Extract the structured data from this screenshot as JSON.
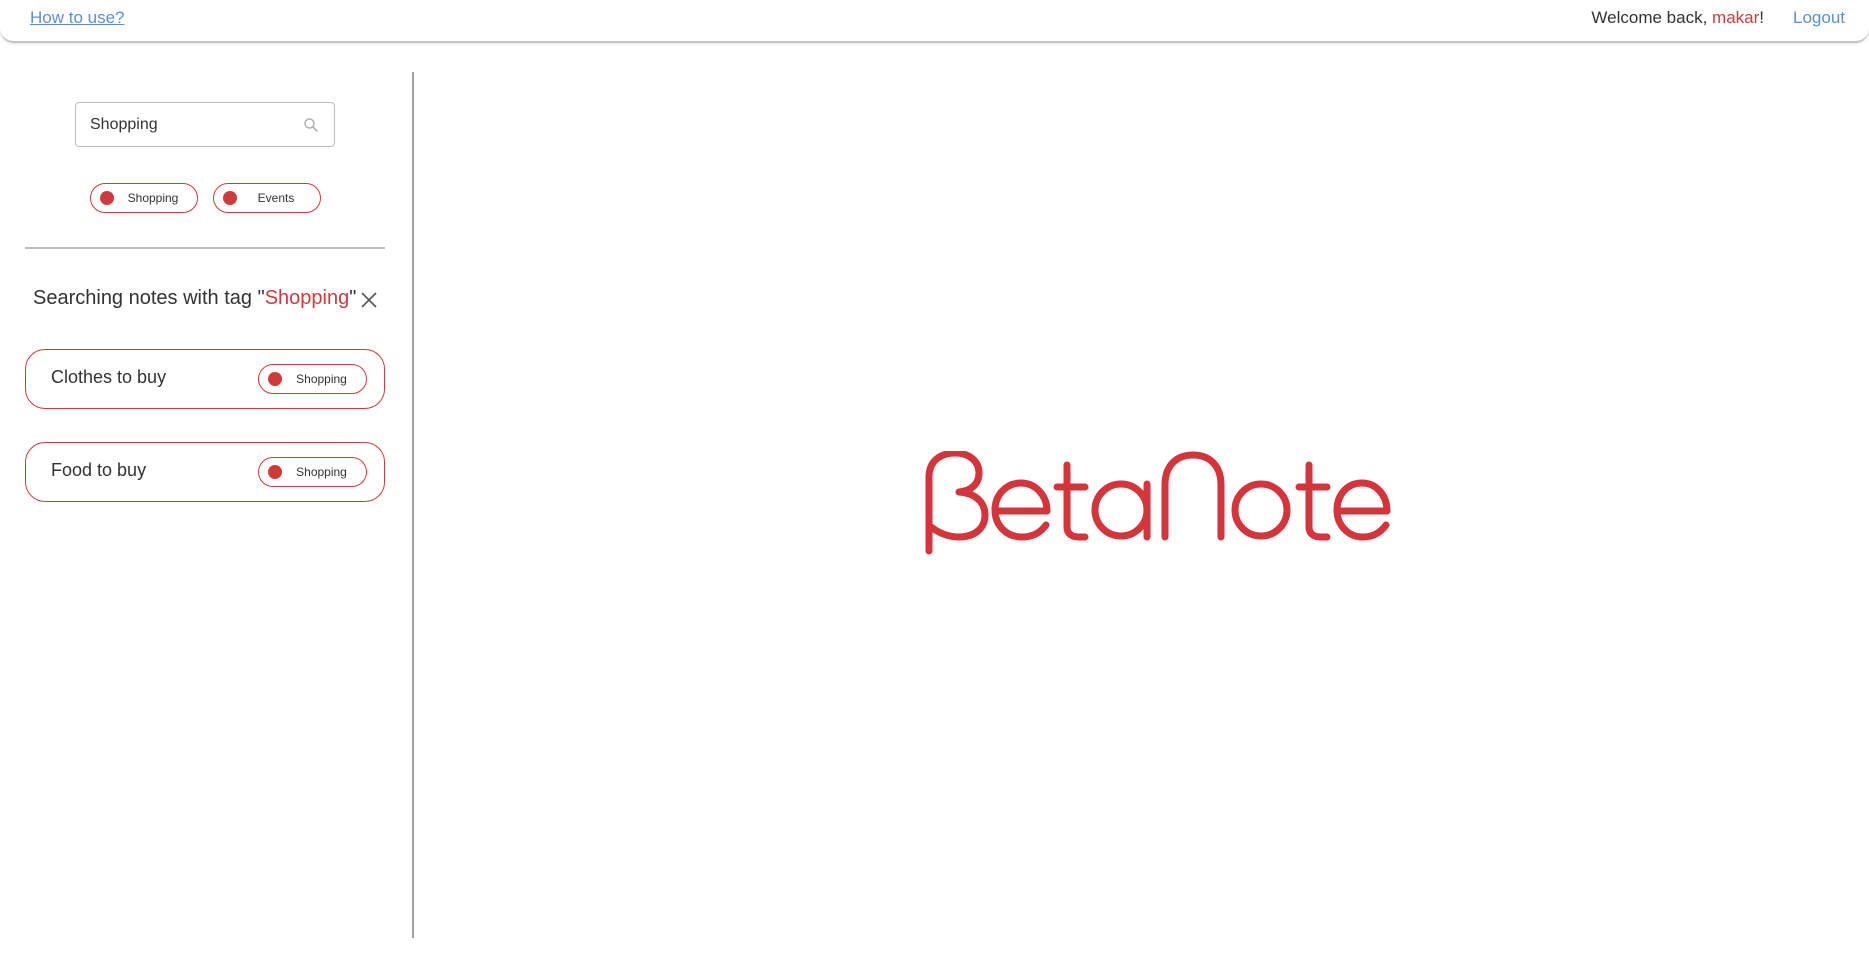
{
  "header": {
    "help_link": "How to use?",
    "welcome_prefix": "Welcome back, ",
    "username": "makar",
    "welcome_suffix": "!",
    "logout_label": "Logout"
  },
  "sidebar": {
    "search": {
      "value": "Shopping",
      "icon": "search-icon"
    },
    "tag_filters": [
      {
        "label": "Shopping",
        "color": "#d13a3a"
      },
      {
        "label": "Events",
        "color": "#d13a3a"
      }
    ],
    "search_heading": {
      "prefix": "Searching notes with tag \"",
      "tag": "Shopping",
      "suffix": "\""
    },
    "notes": [
      {
        "title": "Clothes to buy",
        "tag": "Shopping"
      },
      {
        "title": "Food to buy",
        "tag": "Shopping"
      }
    ]
  },
  "main": {
    "logo_text": "βetaNote"
  },
  "colors": {
    "accent": "#d13a3a",
    "link": "#5c8fd6",
    "text": "#333333"
  }
}
